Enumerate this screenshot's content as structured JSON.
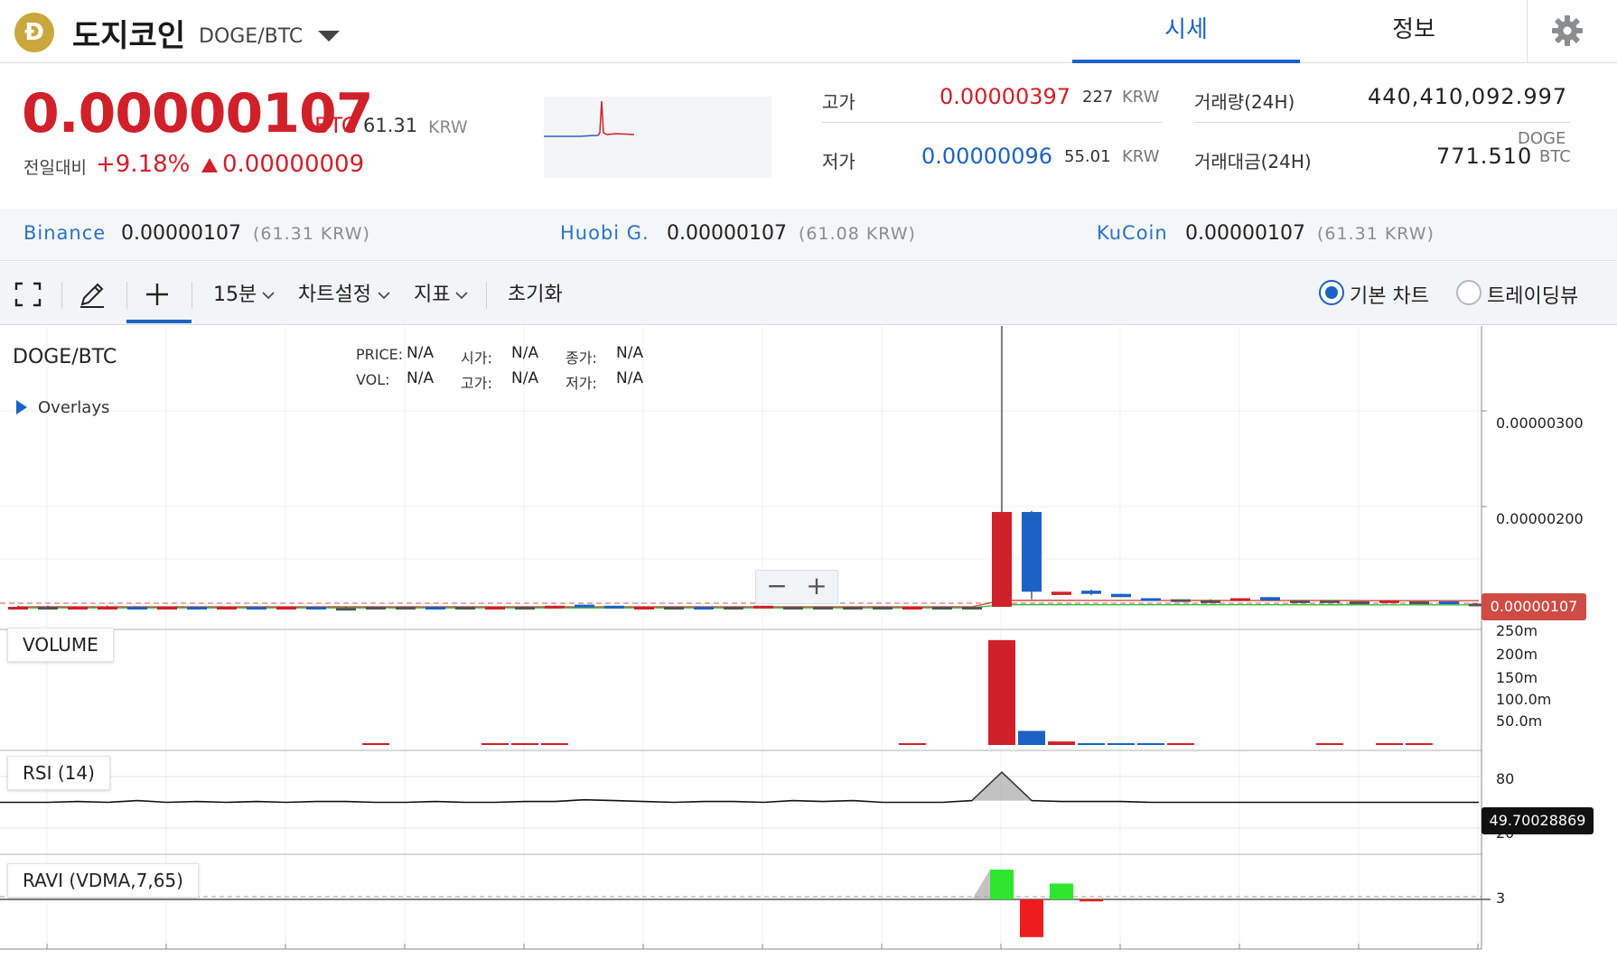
{
  "header": {
    "coin_logo": "Đ",
    "coin_name": "도지코인",
    "pair": "DOGE/BTC",
    "tabs": [
      "시세",
      "정보"
    ],
    "settings_icon": "gear-icon",
    "accent_color": "#1c62c4"
  },
  "summary": {
    "price": "0.00000107",
    "unit": "BTC",
    "krw": "61.31",
    "krw_unit": "KRW",
    "change_label": "전일대비",
    "change_pct": "+9.18%",
    "change_value": "0.00000009",
    "up_color": "#d0202a",
    "down_color": "#1c62c4",
    "high_label": "고가",
    "high_value": "0.00000397",
    "high_krw": "227",
    "high_krw_unit": "KRW",
    "low_label": "저가",
    "low_value": "0.00000096",
    "low_krw": "55.01",
    "low_krw_unit": "KRW",
    "volume_label": "거래량(24H)",
    "volume_value": "440,410,092.997",
    "volume_unit": "DOGE",
    "amount_label": "거래대금(24H)",
    "amount_value": "771.510",
    "amount_unit": "BTC"
  },
  "exchanges": [
    {
      "name": "Binance",
      "price": "0.00000107",
      "krw": "(61.31 KRW)"
    },
    {
      "name": "Huobi G.",
      "price": "0.00000107",
      "krw": "(61.08 KRW)"
    },
    {
      "name": "KuCoin",
      "price": "0.00000107",
      "krw": "(61.31 KRW)"
    }
  ],
  "toolbar": {
    "fullscreen_icon": "fullscreen-icon",
    "draw_icon": "pencil-icon",
    "crosshair_icon": "crosshair-icon",
    "interval": "15분",
    "chart_settings": "차트설정",
    "indicators": "지표",
    "reset": "초기화",
    "basic_chart": "기본 차트",
    "tradingview": "트레이딩뷰",
    "selected_view": "기본 차트"
  },
  "chart": {
    "title": "DOGE/BTC",
    "info": [
      {
        "key": "PRICE:",
        "value": "N/A"
      },
      {
        "key": "시가:",
        "value": "N/A"
      },
      {
        "key": "종가:",
        "value": "N/A"
      },
      {
        "key": "VOL:",
        "value": "N/A"
      },
      {
        "key": "고가:",
        "value": "N/A"
      },
      {
        "key": "저가:",
        "value": "N/A"
      }
    ],
    "overlays_label": "Overlays",
    "zoom_out": "−",
    "zoom_in": "+",
    "price_axis": [
      "0.00000300",
      "0.00000200"
    ],
    "last_price_tag": "0.00000107",
    "volume_label": "VOLUME",
    "volume_axis": [
      "250m",
      "200m",
      "150m",
      "100.0m",
      "50.0m"
    ],
    "rsi_label": "RSI (14)",
    "rsi_axis": [
      "80",
      "20"
    ],
    "rsi_tag": "49.70028869",
    "ravi_label": "RAVI (VDMA,7,65)",
    "ravi_axis": "3"
  },
  "chart_data": {
    "type": "candlestick",
    "price_ylim": [
      1e-06,
      4e-06
    ],
    "candles": [
      {
        "o": 1.07e-06,
        "c": 1.06e-06,
        "h": 1.08e-06,
        "l": 1.06e-06,
        "dir": "up"
      },
      {
        "o": 1.07e-06,
        "c": 1.07e-06,
        "h": 1.08e-06,
        "l": 1.07e-06,
        "dir": "flat"
      },
      {
        "o": 1.07e-06,
        "c": 1.06e-06,
        "h": 1.07e-06,
        "l": 1.06e-06,
        "dir": "up"
      },
      {
        "o": 1.07e-06,
        "c": 1.06e-06,
        "h": 1.08e-06,
        "l": 1.06e-06,
        "dir": "up"
      },
      {
        "o": 1.06e-06,
        "c": 1.07e-06,
        "h": 1.07e-06,
        "l": 1.06e-06,
        "dir": "down"
      },
      {
        "o": 1.07e-06,
        "c": 1.06e-06,
        "h": 1.07e-06,
        "l": 1.06e-06,
        "dir": "up"
      },
      {
        "o": 1.06e-06,
        "c": 1.07e-06,
        "h": 1.07e-06,
        "l": 1.06e-06,
        "dir": "down"
      },
      {
        "o": 1.07e-06,
        "c": 1.06e-06,
        "h": 1.07e-06,
        "l": 1.06e-06,
        "dir": "up"
      },
      {
        "o": 1.06e-06,
        "c": 1.07e-06,
        "h": 1.07e-06,
        "l": 1.06e-06,
        "dir": "down"
      },
      {
        "o": 1.07e-06,
        "c": 1.06e-06,
        "h": 1.07e-06,
        "l": 1.06e-06,
        "dir": "up"
      },
      {
        "o": 1.06e-06,
        "c": 1.07e-06,
        "h": 1.07e-06,
        "l": 1.06e-06,
        "dir": "down"
      },
      {
        "o": 1.06e-06,
        "c": 1.06e-06,
        "h": 1.07e-06,
        "l": 1.06e-06,
        "dir": "flat"
      },
      {
        "o": 1.07e-06,
        "c": 1.07e-06,
        "h": 1.07e-06,
        "l": 1.06e-06,
        "dir": "flat"
      },
      {
        "o": 1.07e-06,
        "c": 1.07e-06,
        "h": 1.07e-06,
        "l": 1.07e-06,
        "dir": "flat"
      },
      {
        "o": 1.06e-06,
        "c": 1.07e-06,
        "h": 1.07e-06,
        "l": 1.06e-06,
        "dir": "down"
      },
      {
        "o": 1.07e-06,
        "c": 1.07e-06,
        "h": 1.07e-06,
        "l": 1.07e-06,
        "dir": "flat"
      },
      {
        "o": 1.07e-06,
        "c": 1.06e-06,
        "h": 1.07e-06,
        "l": 1.06e-06,
        "dir": "up"
      },
      {
        "o": 1.07e-06,
        "c": 1.07e-06,
        "h": 1.07e-06,
        "l": 1.06e-06,
        "dir": "flat"
      },
      {
        "o": 1.07e-06,
        "c": 1.08e-06,
        "h": 1.08e-06,
        "l": 1.07e-06,
        "dir": "up"
      },
      {
        "o": 1.08e-06,
        "c": 1.09e-06,
        "h": 1.09e-06,
        "l": 1.08e-06,
        "dir": "down"
      },
      {
        "o": 1.08e-06,
        "c": 1.07e-06,
        "h": 1.08e-06,
        "l": 1.07e-06,
        "dir": "down"
      },
      {
        "o": 1.07e-06,
        "c": 1.06e-06,
        "h": 1.07e-06,
        "l": 1.06e-06,
        "dir": "up"
      },
      {
        "o": 1.07e-06,
        "c": 1.07e-06,
        "h": 1.07e-06,
        "l": 1.07e-06,
        "dir": "flat"
      },
      {
        "o": 1.07e-06,
        "c": 1.06e-06,
        "h": 1.07e-06,
        "l": 1.06e-06,
        "dir": "down"
      },
      {
        "o": 1.07e-06,
        "c": 1.07e-06,
        "h": 1.07e-06,
        "l": 1.07e-06,
        "dir": "flat"
      },
      {
        "o": 1.07e-06,
        "c": 1.08e-06,
        "h": 1.08e-06,
        "l": 1.07e-06,
        "dir": "up"
      },
      {
        "o": 1.07e-06,
        "c": 1.07e-06,
        "h": 1.07e-06,
        "l": 1.07e-06,
        "dir": "flat"
      },
      {
        "o": 1.07e-06,
        "c": 1.07e-06,
        "h": 1.07e-06,
        "l": 1.07e-06,
        "dir": "flat"
      },
      {
        "o": 1.07e-06,
        "c": 1.07e-06,
        "h": 1.07e-06,
        "l": 1.07e-06,
        "dir": "flat"
      },
      {
        "o": 1.07e-06,
        "c": 1.07e-06,
        "h": 1.07e-06,
        "l": 1.07e-06,
        "dir": "flat"
      },
      {
        "o": 1.07e-06,
        "c": 1.06e-06,
        "h": 1.07e-06,
        "l": 1.06e-06,
        "dir": "up"
      },
      {
        "o": 1.07e-06,
        "c": 1.07e-06,
        "h": 1.07e-06,
        "l": 1.07e-06,
        "dir": "flat"
      },
      {
        "o": 1.07e-06,
        "c": 1.07e-06,
        "h": 1.07e-06,
        "l": 1.07e-06,
        "dir": "flat"
      },
      {
        "o": 1.07e-06,
        "c": 1.95e-06,
        "h": 3.97e-06,
        "l": 1.07e-06,
        "dir": "up"
      },
      {
        "o": 1.95e-06,
        "c": 1.21e-06,
        "h": 1.96e-06,
        "l": 1.14e-06,
        "dir": "down"
      },
      {
        "o": 1.18e-06,
        "c": 1.21e-06,
        "h": 1.21e-06,
        "l": 1.18e-06,
        "dir": "up"
      },
      {
        "o": 1.22e-06,
        "c": 1.19e-06,
        "h": 1.23e-06,
        "l": 1.18e-06,
        "dir": "down"
      },
      {
        "o": 1.19e-06,
        "c": 1.16e-06,
        "h": 1.19e-06,
        "l": 1.16e-06,
        "dir": "down"
      },
      {
        "o": 1.15e-06,
        "c": 1.13e-06,
        "h": 1.15e-06,
        "l": 1.13e-06,
        "dir": "down"
      },
      {
        "o": 1.14e-06,
        "c": 1.14e-06,
        "h": 1.14e-06,
        "l": 1.13e-06,
        "dir": "flat"
      },
      {
        "o": 1.13e-06,
        "c": 1.13e-06,
        "h": 1.14e-06,
        "l": 1.13e-06,
        "dir": "flat"
      },
      {
        "o": 1.13e-06,
        "c": 1.15e-06,
        "h": 1.15e-06,
        "l": 1.13e-06,
        "dir": "up"
      },
      {
        "o": 1.16e-06,
        "c": 1.13e-06,
        "h": 1.16e-06,
        "l": 1.13e-06,
        "dir": "down"
      },
      {
        "o": 1.13e-06,
        "c": 1.13e-06,
        "h": 1.13e-06,
        "l": 1.13e-06,
        "dir": "flat"
      },
      {
        "o": 1.13e-06,
        "c": 1.12e-06,
        "h": 1.13e-06,
        "l": 1.12e-06,
        "dir": "flat"
      },
      {
        "o": 1.12e-06,
        "c": 1.12e-06,
        "h": 1.12e-06,
        "l": 1.11e-06,
        "dir": "flat"
      },
      {
        "o": 1.11e-06,
        "c": 1.13e-06,
        "h": 1.13e-06,
        "l": 1.11e-06,
        "dir": "up"
      },
      {
        "o": 1.11e-06,
        "c": 1.12e-06,
        "h": 1.12e-06,
        "l": 1.11e-06,
        "dir": "flat"
      },
      {
        "o": 1.12e-06,
        "c": 1.1e-06,
        "h": 1.12e-06,
        "l": 1.1e-06,
        "dir": "down"
      },
      {
        "o": 1.1e-06,
        "c": 1.1e-06,
        "h": 1.1e-06,
        "l": 1.1e-06,
        "dir": "flat"
      }
    ],
    "volume_millions": [
      0,
      0,
      0,
      0,
      0,
      0,
      0,
      0,
      0,
      0,
      0,
      0,
      1,
      0,
      0,
      0,
      1,
      1,
      1,
      0,
      0,
      0,
      0,
      0,
      0,
      0,
      0,
      0,
      0,
      0,
      1,
      0,
      0,
      238,
      32,
      8,
      3,
      1,
      1,
      1,
      0,
      0,
      0,
      0,
      1,
      0,
      1,
      3,
      0,
      0
    ],
    "volume_ylim": [
      0,
      250
    ],
    "rsi_values": [
      50,
      50,
      51,
      50,
      52,
      50,
      51,
      50,
      51,
      50,
      51,
      51,
      50,
      50,
      51,
      50,
      50,
      51,
      51,
      53,
      52,
      51,
      50,
      51,
      51,
      50,
      52,
      51,
      52,
      50,
      50,
      50,
      52,
      85,
      52,
      51,
      51,
      51,
      50,
      50,
      50,
      50,
      50,
      50,
      50,
      50,
      50,
      50,
      50,
      50
    ],
    "rsi_ylim": [
      0,
      100
    ],
    "ravi_values": [
      0,
      0,
      0,
      0,
      0,
      0,
      0,
      0,
      0,
      0,
      0,
      0,
      0,
      0,
      0,
      0,
      0,
      0,
      0,
      0,
      0,
      0,
      0,
      0,
      0,
      0,
      0,
      0,
      0,
      0,
      0,
      0,
      0,
      30,
      -38,
      16,
      -2,
      0,
      0,
      0,
      0,
      0,
      0,
      0,
      0,
      0,
      0,
      0,
      0,
      0
    ],
    "ravi_ylim": [
      -45,
      45
    ]
  }
}
